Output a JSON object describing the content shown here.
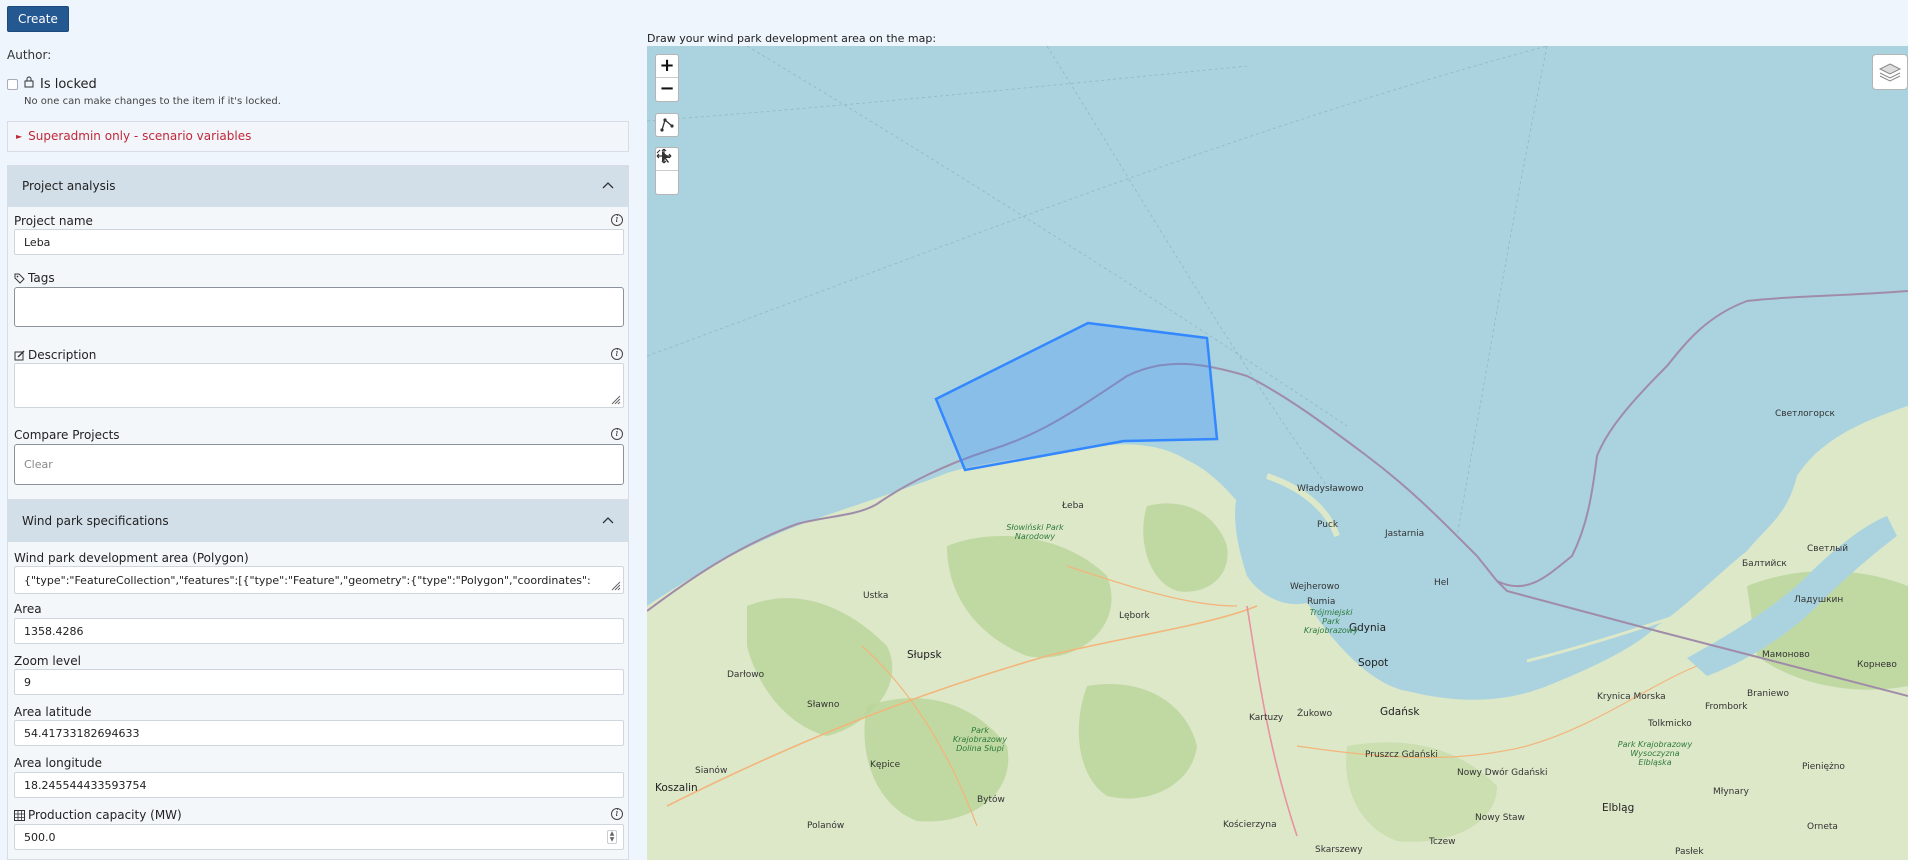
{
  "toolbar": {
    "create_label": "Create"
  },
  "meta": {
    "author_label": "Author:",
    "is_locked_label": "Is locked",
    "is_locked_help": "No one can make changes to the item if it's locked.",
    "superadmin_label": "Superadmin only - scenario variables"
  },
  "project_analysis": {
    "title": "Project analysis",
    "project_name_label": "Project name",
    "project_name_value": "Leba",
    "tags_label": "Tags",
    "description_label": "Description",
    "compare_label": "Compare Projects",
    "compare_placeholder": "Clear"
  },
  "wind_park": {
    "title": "Wind park specifications",
    "area_polygon_label": "Wind park development area (Polygon)",
    "area_polygon_value": "{\"type\":\"FeatureCollection\",\"features\":[{\"type\":\"Feature\",\"geometry\":{\"type\":\"Polygon\",\"coordinates\":",
    "area_label": "Area",
    "area_value": "1358.4286",
    "zoom_label": "Zoom level",
    "zoom_value": "9",
    "lat_label": "Area latitude",
    "lat_value": "54.41733182694633",
    "lon_label": "Area longitude",
    "lon_value": "18.245544433593754",
    "capacity_label": "Production capacity (MW)",
    "capacity_value": "500.0"
  },
  "map": {
    "instruction": "Draw your wind park development area on the map:",
    "zoom_in": "+",
    "zoom_out": "−",
    "places": {
      "leba": "Łeba",
      "wladyslawowo": "Władysławowo",
      "puck": "Puck",
      "jastarnia": "Jastarnia",
      "hel": "Hel",
      "wejherowo": "Wejherowo",
      "rumia": "Rumia",
      "gdynia": "Gdynia",
      "sopot": "Sopot",
      "gdansk": "Gdańsk",
      "slupsk": "Słupsk",
      "ustka": "Ustka",
      "darlowo": "Darłowo",
      "slawno": "Sławno",
      "koszalin": "Koszalin",
      "sianow": "Sianów",
      "polanow": "Polanów",
      "kepice": "Kępice",
      "bytow": "Bytów",
      "lebork": "Lębork",
      "kartuzy": "Kartuzy",
      "zukowo": "Żukowo",
      "pruszcz": "Pruszcz Gdański",
      "nowy_dwor": "Nowy Dwór Gdański",
      "nowy_staw": "Nowy Staw",
      "tczew": "Tczew",
      "koscierzyna": "Kościerzyna",
      "skarszewy": "Skarszewy",
      "elblag": "Elbląg",
      "krynica": "Krynica Morska",
      "tolkmicko": "Tolkmicko",
      "frombork": "Frombork",
      "mlynary": "Młynary",
      "paslek": "Pasłek",
      "orneta": "Orneta",
      "pieniezno": "Pieniężno",
      "braniewo": "Braniewo",
      "mamonovo": "Мамоново",
      "korneovo": "Корнево",
      "baltiysk": "Балтийск",
      "ladushkin": "Ладушкин",
      "svetly": "Светлый",
      "svetlogorsk": "Светлогорск",
      "slowinski": "Słowiński Park Narodowy",
      "trojmiejski": "Trójmiejski Park Krajobrazowy",
      "dolina_slupi": "Park Krajobrazowy Dolina Słupi",
      "wysoczyzna": "Park Krajobrazowy Wysoczyzna Elbląska"
    }
  },
  "colors": {
    "accent": "#245891",
    "danger": "#c0283a",
    "sea": "#aad3df",
    "polygon": "#3388ff"
  }
}
